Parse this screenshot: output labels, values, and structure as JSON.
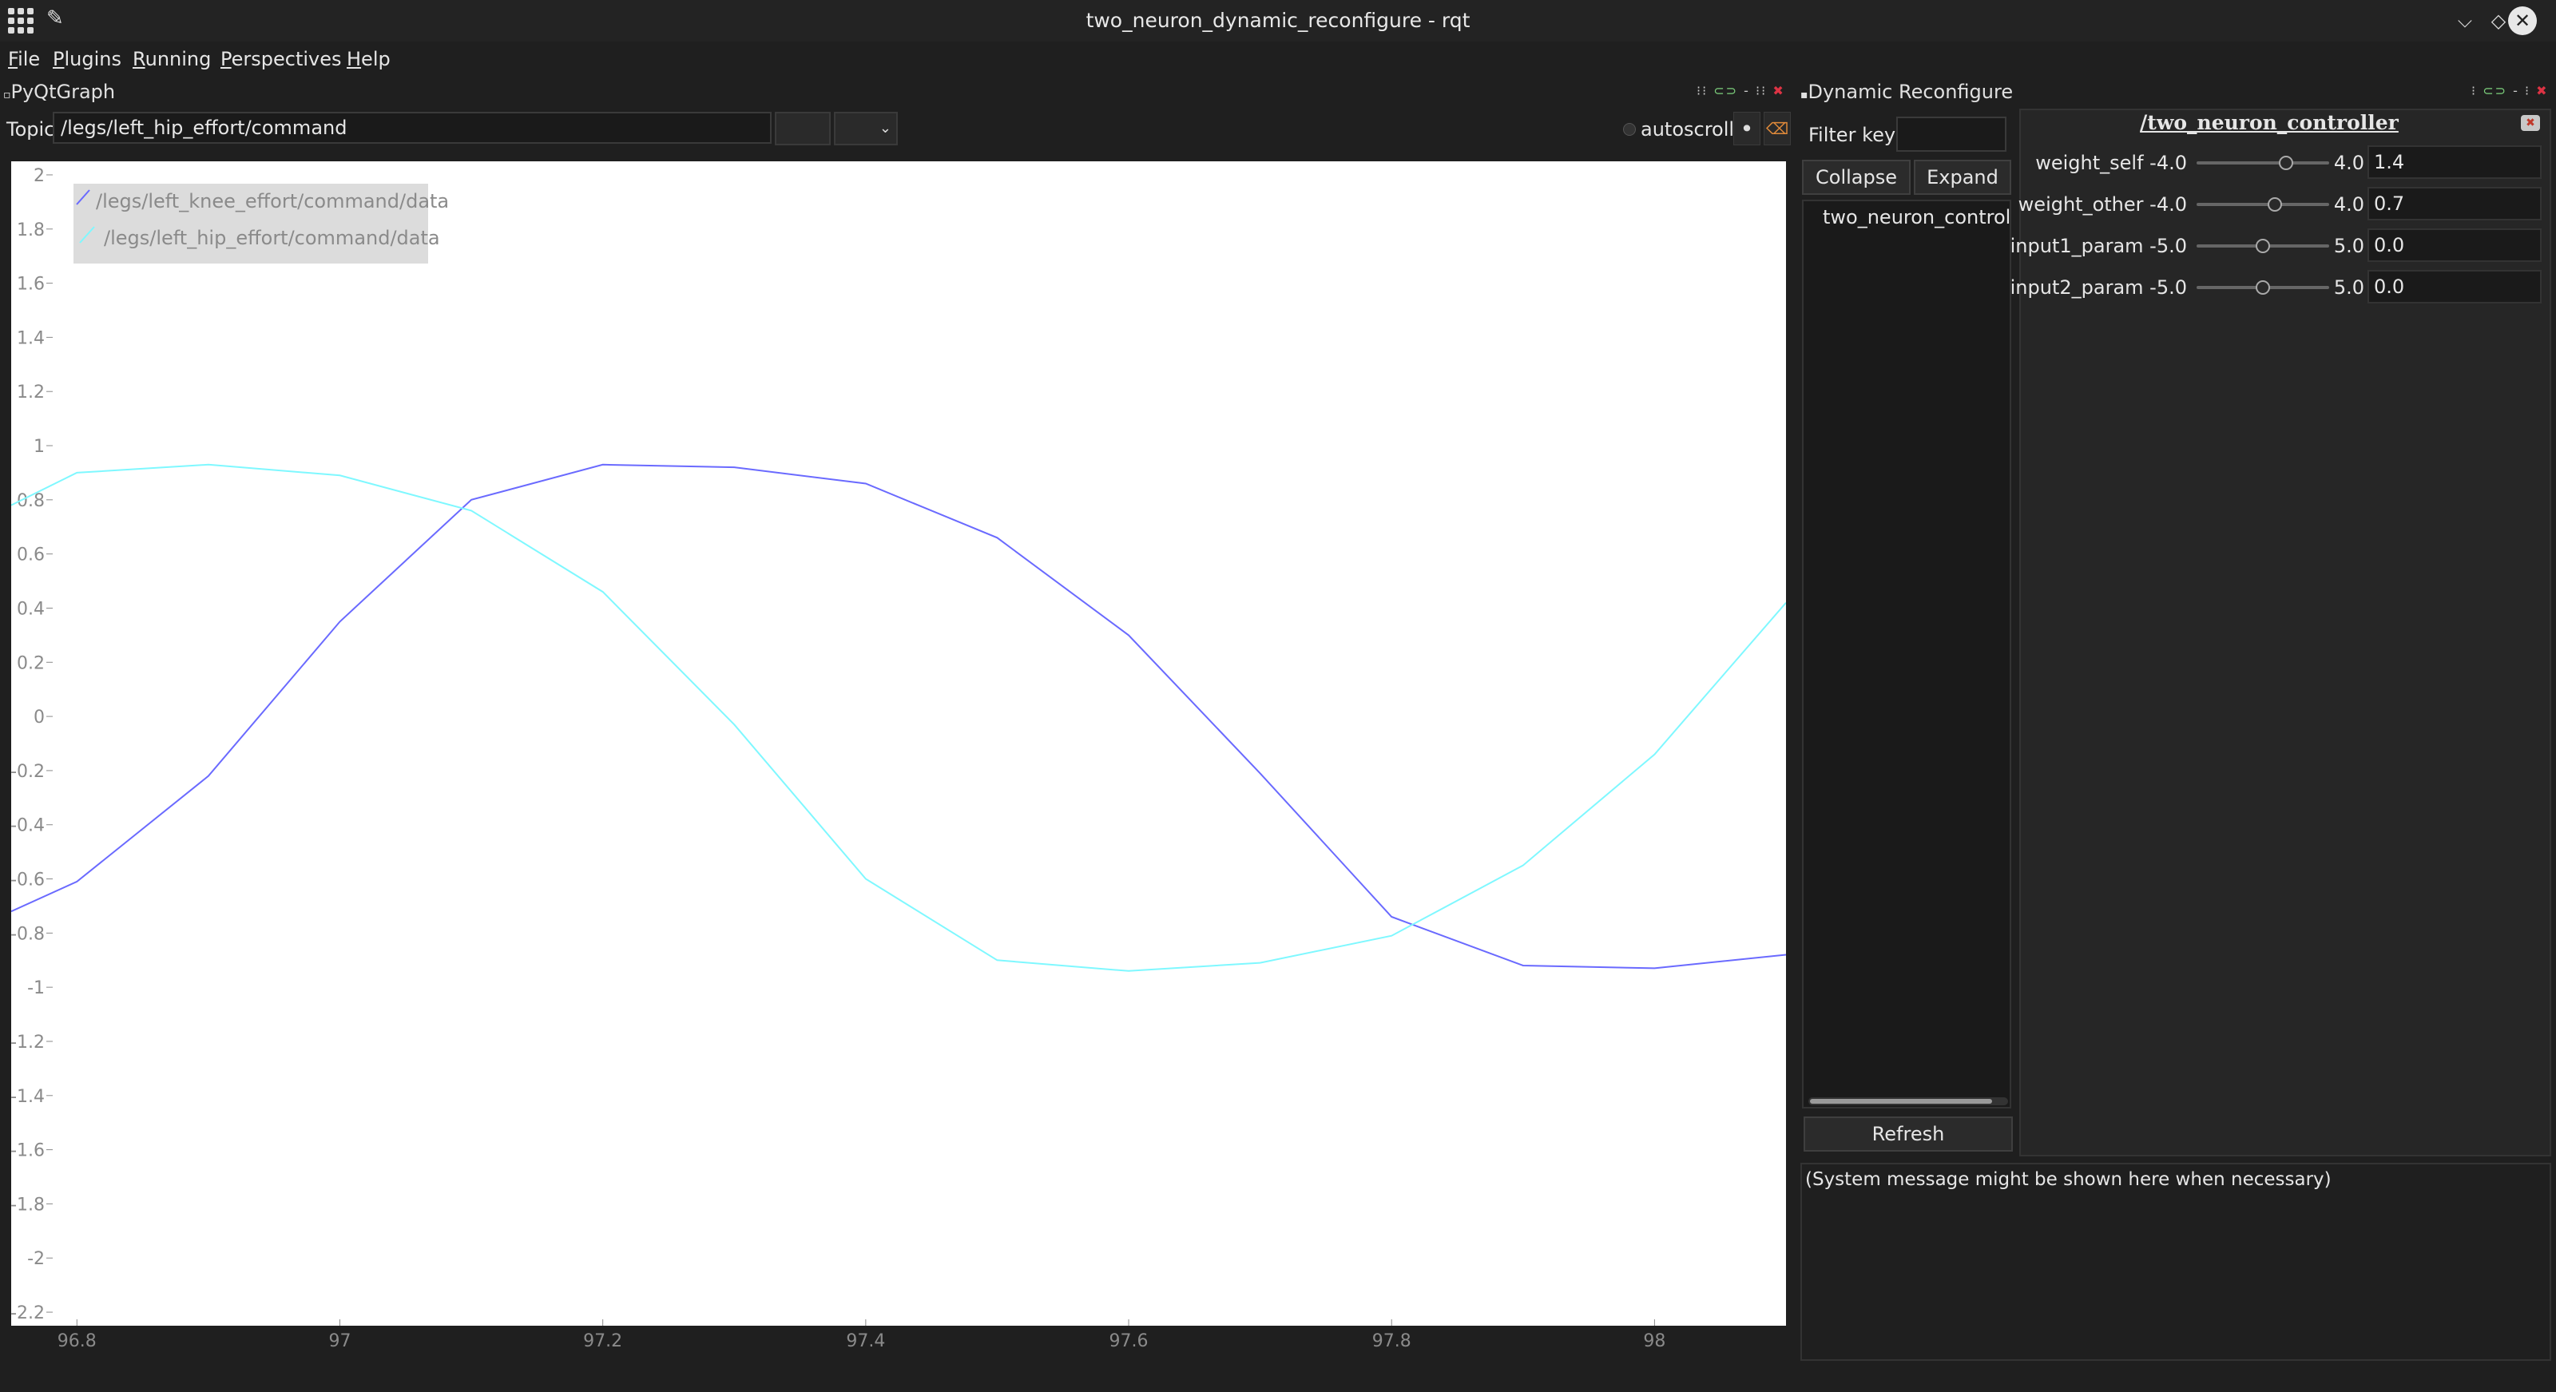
{
  "window": {
    "title": "two_neuron_dynamic_reconfigure - rqt"
  },
  "menu": [
    "File",
    "Plugins",
    "Running",
    "Perspectives",
    "Help"
  ],
  "plot_panel": {
    "title": "PyQtGraph",
    "topic_label": "Topic",
    "topic_value": "/legs/left_hip_effort/command",
    "autoscroll_label": "autoscroll",
    "autoscroll_checked": false
  },
  "reconfigure_panel": {
    "title": "Dynamic Reconfigure",
    "filter_label": "Filter key:",
    "filter_value": "",
    "collapse_all": "Collapse all",
    "expand_all": "Expand all",
    "tree_items": [
      "two_neuron_controller"
    ],
    "refresh": "Refresh",
    "node_title": "/two_neuron_controller",
    "params": [
      {
        "name": "weight_self",
        "min": "-4.0",
        "max": "4.0",
        "value": "1.4",
        "fraction": 0.675
      },
      {
        "name": "weight_other",
        "min": "-4.0",
        "max": "4.0",
        "value": "0.7",
        "fraction": 0.5875
      },
      {
        "name": "input1_param",
        "min": "-5.0",
        "max": "5.0",
        "value": "0.0",
        "fraction": 0.5
      },
      {
        "name": "input2_param",
        "min": "-5.0",
        "max": "5.0",
        "value": "0.0",
        "fraction": 0.5
      }
    ],
    "system_message": "(System message might be shown here when necessary)"
  },
  "colors": {
    "series_blue": "#6a6aff",
    "series_cyan": "#7ff8ff",
    "plot_background": "#ffffff",
    "legend_background": "#dcdcdc",
    "text_grey": "#8a8a8a"
  },
  "chart_data": {
    "type": "line",
    "xlim": [
      96.75,
      98.1
    ],
    "ylim": [
      -2.25,
      2.05
    ],
    "x_ticks": [
      "96.8",
      "97",
      "97.2",
      "97.4",
      "97.6",
      "97.8",
      "98"
    ],
    "y_ticks": [
      "2",
      "1.8",
      "1.6",
      "1.4",
      "1.2",
      "1",
      "0.8",
      "0.6",
      "0.4",
      "0.2",
      "0",
      "-0.2",
      "-0.4",
      "-0.6",
      "-0.8",
      "-1",
      "-1.2",
      "-1.4",
      "-1.6",
      "-1.8",
      "-2",
      "-2.2"
    ],
    "legend_position": "top-left",
    "series": [
      {
        "name": "/legs/left_knee_effort/command/data",
        "color": "#6a6aff",
        "points": [
          [
            96.75,
            -0.72
          ],
          [
            96.8,
            -0.61
          ],
          [
            96.9,
            -0.22
          ],
          [
            97.0,
            0.35
          ],
          [
            97.1,
            0.8
          ],
          [
            97.2,
            0.93
          ],
          [
            97.3,
            0.92
          ],
          [
            97.4,
            0.86
          ],
          [
            97.5,
            0.66
          ],
          [
            97.6,
            0.3
          ],
          [
            97.7,
            -0.21
          ],
          [
            97.8,
            -0.74
          ],
          [
            97.9,
            -0.92
          ],
          [
            98.0,
            -0.93
          ],
          [
            98.1,
            -0.88
          ]
        ]
      },
      {
        "name": "/legs/left_hip_effort/command/data",
        "color": "#7ff8ff",
        "points": [
          [
            96.75,
            0.78
          ],
          [
            96.8,
            0.9
          ],
          [
            96.9,
            0.93
          ],
          [
            97.0,
            0.89
          ],
          [
            97.1,
            0.76
          ],
          [
            97.2,
            0.46
          ],
          [
            97.3,
            -0.03
          ],
          [
            97.4,
            -0.6
          ],
          [
            97.5,
            -0.9
          ],
          [
            97.6,
            -0.94
          ],
          [
            97.7,
            -0.91
          ],
          [
            97.8,
            -0.81
          ],
          [
            97.9,
            -0.55
          ],
          [
            98.0,
            -0.14
          ],
          [
            98.1,
            0.42
          ]
        ]
      }
    ]
  }
}
